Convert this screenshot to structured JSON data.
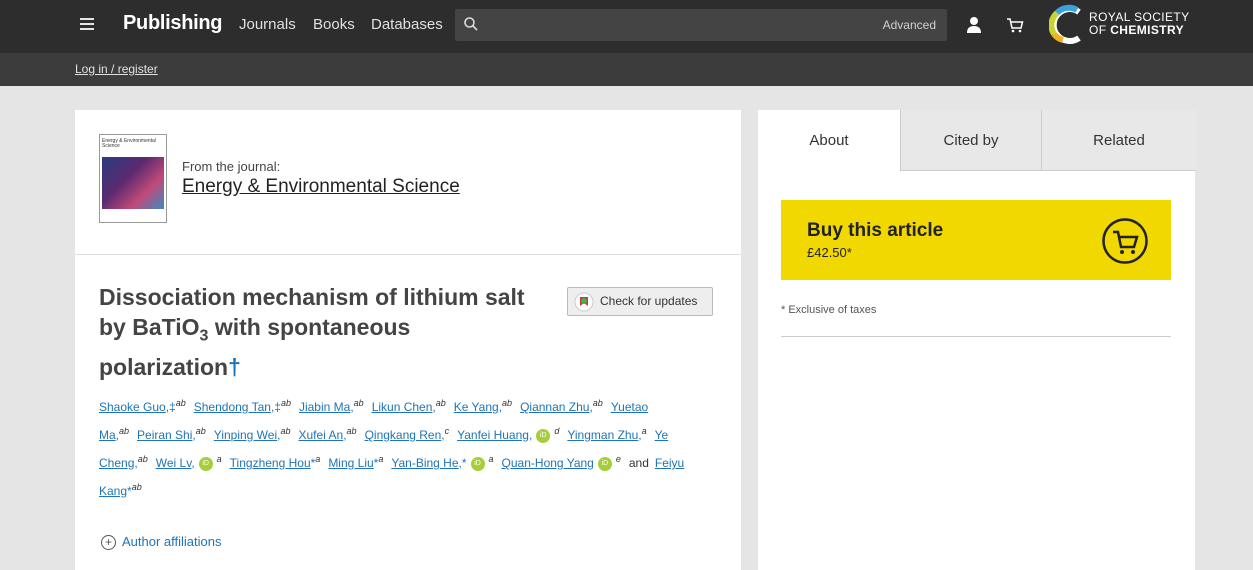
{
  "header": {
    "brand": "Publishing",
    "nav": [
      "Journals",
      "Books",
      "Databases"
    ],
    "search": {
      "placeholder": "",
      "advanced_label": "Advanced"
    },
    "logo": {
      "line1": "ROYAL SOCIETY",
      "line2_prefix": "OF ",
      "line2_bold": "CHEMISTRY"
    },
    "login_label": "Log in / register"
  },
  "journal": {
    "from_label": "From the journal:",
    "name": "Energy & Environmental Science",
    "cover_title": "Energy & Environmental Science"
  },
  "article": {
    "title_part1": "Dissociation mechanism of lithium salt by BaTiO",
    "title_sub": "3",
    "title_part2": " with spontaneous polarization",
    "title_dagger": "†",
    "check_updates_label": "Check for updates"
  },
  "authors": [
    {
      "name": "Shaoke Guo",
      "mark": ",‡",
      "aff": "ab",
      "orcid": false
    },
    {
      "name": "Shendong Tan",
      "mark": ",‡",
      "aff": "ab",
      "orcid": false
    },
    {
      "name": "Jiabin Ma",
      "mark": ",",
      "aff": "ab",
      "orcid": false
    },
    {
      "name": "Likun Chen",
      "mark": ",",
      "aff": "ab",
      "orcid": false
    },
    {
      "name": "Ke Yang",
      "mark": ",",
      "aff": "ab",
      "orcid": false
    },
    {
      "name": "Qiannan Zhu",
      "mark": ",",
      "aff": "ab",
      "orcid": false
    },
    {
      "name": "Yuetao Ma",
      "mark": ",",
      "aff": "ab",
      "orcid": false
    },
    {
      "name": "Peiran Shi",
      "mark": ",",
      "aff": "ab",
      "orcid": false
    },
    {
      "name": "Yinping Wei",
      "mark": ",",
      "aff": "ab",
      "orcid": false
    },
    {
      "name": "Xufei An",
      "mark": ",",
      "aff": "ab",
      "orcid": false
    },
    {
      "name": "Qingkang Ren",
      "mark": ",",
      "aff": "c",
      "orcid": false
    },
    {
      "name": "Yanfei Huang",
      "mark": ",",
      "aff": "d",
      "orcid": true
    },
    {
      "name": "Yingman Zhu",
      "mark": ",",
      "aff": "a",
      "orcid": false
    },
    {
      "name": "Ye Cheng",
      "mark": ",",
      "aff": "ab",
      "orcid": false
    },
    {
      "name": "Wei Lv",
      "mark": ",",
      "aff": "a",
      "orcid": true
    },
    {
      "name": "Tingzheng Hou",
      "mark": "*",
      "aff": "a",
      "orcid": false
    },
    {
      "name": "Ming Liu",
      "mark": "*",
      "aff": "a",
      "orcid": false
    },
    {
      "name": "Yan-Bing He",
      "mark": ",*",
      "aff": "a",
      "orcid": true
    },
    {
      "name": "Quan-Hong Yang",
      "mark": "",
      "aff": "e",
      "orcid": true
    },
    {
      "name": "Feiyu Kang",
      "mark": "*",
      "aff": "ab",
      "orcid": false
    }
  ],
  "authors_and": "and",
  "affiliations_label": "Author affiliations",
  "sidebar": {
    "tabs": [
      "About",
      "Cited by",
      "Related"
    ],
    "buy": {
      "title": "Buy this article",
      "price": "£42.50*"
    },
    "taxes_note": "* Exclusive of taxes"
  },
  "colors": {
    "accent": "#1f74b8",
    "buy": "#f0d800",
    "topbar": "#2d2d2d",
    "orcid": "#a6ce39"
  }
}
